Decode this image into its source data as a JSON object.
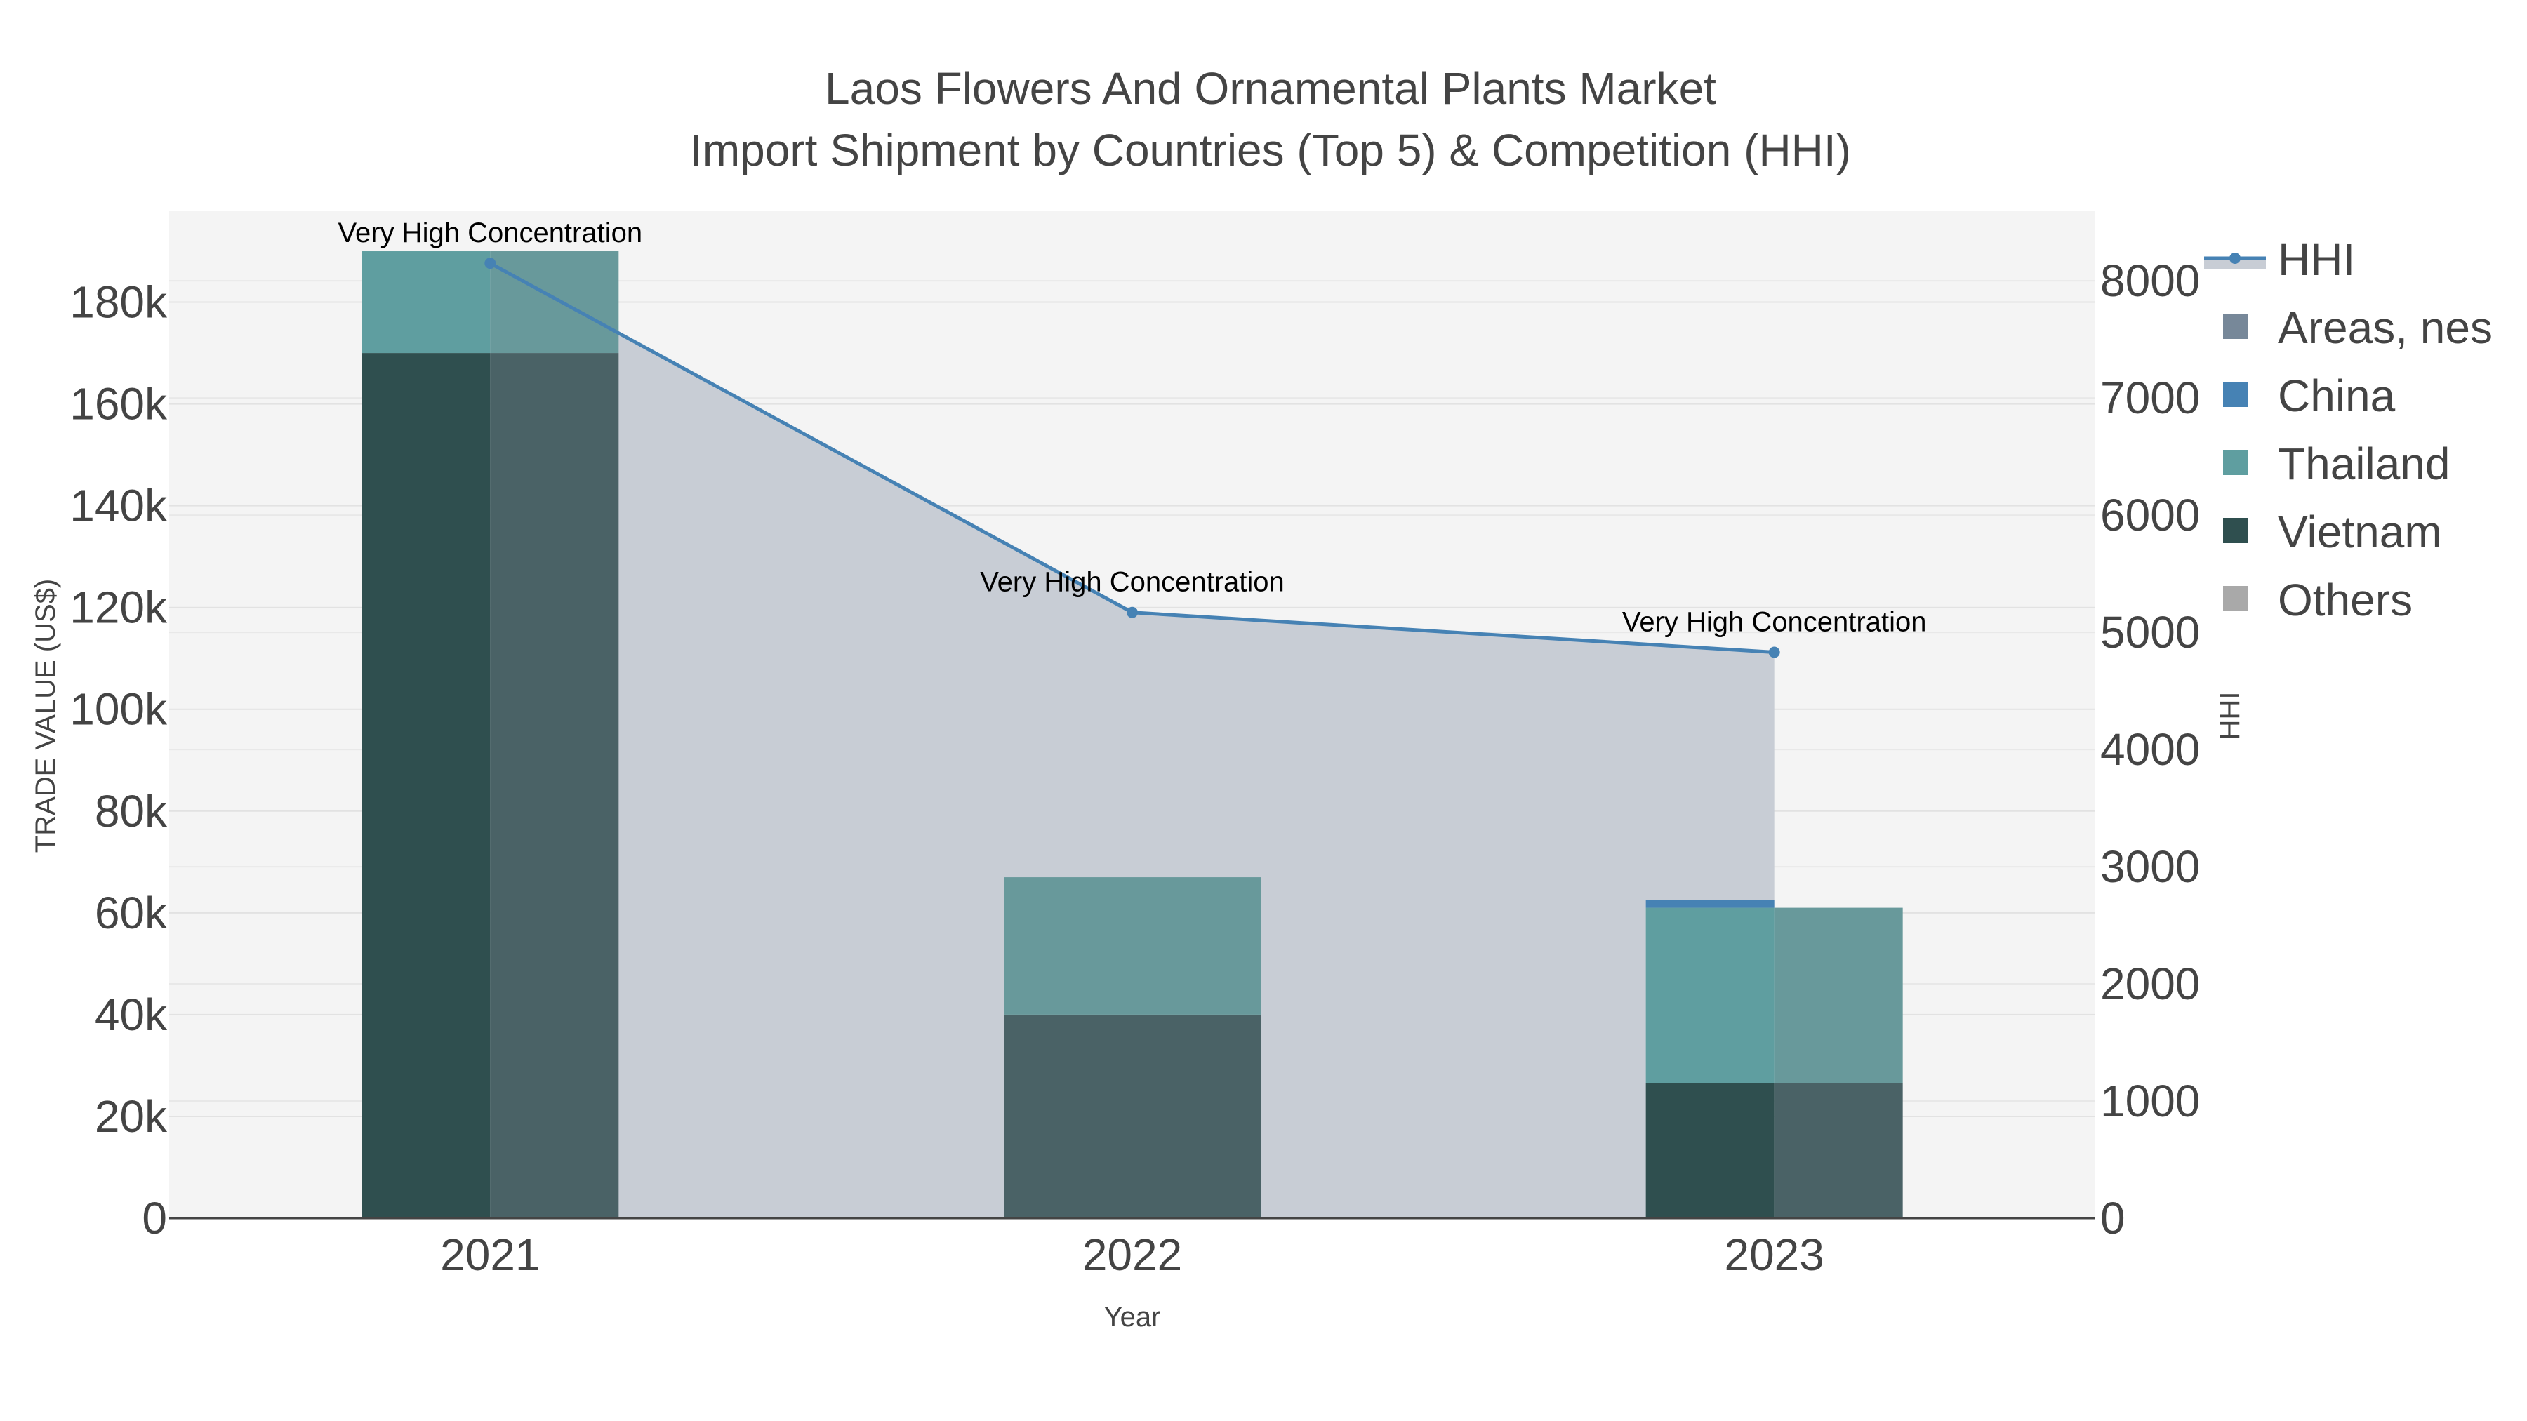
{
  "chart_data": {
    "type": "bar",
    "title": "Laos Flowers And Ornamental Plants Market",
    "subtitle": "Import Shipment by Countries (Top 5) & Competition (HHI)",
    "xlabel": "Year",
    "ylabel": "TRADE VALUE (US$)",
    "y2label": "HHI",
    "categories": [
      "2021",
      "2022",
      "2023"
    ],
    "ylim": [
      0,
      198000
    ],
    "y2lim": [
      0,
      8600
    ],
    "yticks": [
      {
        "value": 0,
        "label": "0"
      },
      {
        "value": 20000,
        "label": "20k"
      },
      {
        "value": 40000,
        "label": "40k"
      },
      {
        "value": 60000,
        "label": "60k"
      },
      {
        "value": 80000,
        "label": "80k"
      },
      {
        "value": 100000,
        "label": "100k"
      },
      {
        "value": 120000,
        "label": "120k"
      },
      {
        "value": 140000,
        "label": "140k"
      },
      {
        "value": 160000,
        "label": "160k"
      },
      {
        "value": 180000,
        "label": "180k"
      }
    ],
    "y2ticks": [
      {
        "value": 0,
        "label": "0"
      },
      {
        "value": 1000,
        "label": "1000"
      },
      {
        "value": 2000,
        "label": "2000"
      },
      {
        "value": 3000,
        "label": "3000"
      },
      {
        "value": 4000,
        "label": "4000"
      },
      {
        "value": 5000,
        "label": "5000"
      },
      {
        "value": 6000,
        "label": "6000"
      },
      {
        "value": 7000,
        "label": "7000"
      },
      {
        "value": 8000,
        "label": "8000"
      }
    ],
    "stack_series": [
      {
        "name": "Vietnam",
        "color": "#2f4f4f",
        "values": [
          170000,
          0,
          26500
        ]
      },
      {
        "name": "Thailand",
        "color": "#5f9ea0",
        "values": [
          20000,
          0,
          34500
        ]
      },
      {
        "name": "China",
        "color": "#4682b4",
        "values": [
          0,
          0,
          1500
        ]
      }
    ],
    "overlay_series": [
      {
        "name": "Vietnam",
        "color": "#4a6266",
        "values": [
          170000,
          40000,
          26500
        ]
      },
      {
        "name": "Thailand",
        "color": "#68999b",
        "values": [
          20000,
          27000,
          34500
        ]
      }
    ],
    "hhi": {
      "name": "HHI",
      "color": "#4682b4",
      "values": [
        8150,
        5170,
        4830
      ]
    },
    "annotations": [
      "Very High Concentration",
      "Very High Concentration",
      "Very High Concentration"
    ],
    "legend": [
      {
        "name": "HHI",
        "kind": "line",
        "color": "#4682b4"
      },
      {
        "name": "Areas, nes",
        "kind": "box",
        "color": "#778899"
      },
      {
        "name": "China",
        "kind": "box",
        "color": "#4682b4"
      },
      {
        "name": "Thailand",
        "kind": "box",
        "color": "#5f9ea0"
      },
      {
        "name": "Vietnam",
        "kind": "box",
        "color": "#2f4f4f"
      },
      {
        "name": "Others",
        "kind": "box",
        "color": "#a9a9a9"
      }
    ],
    "legend_position": "top-right",
    "grid": true
  }
}
